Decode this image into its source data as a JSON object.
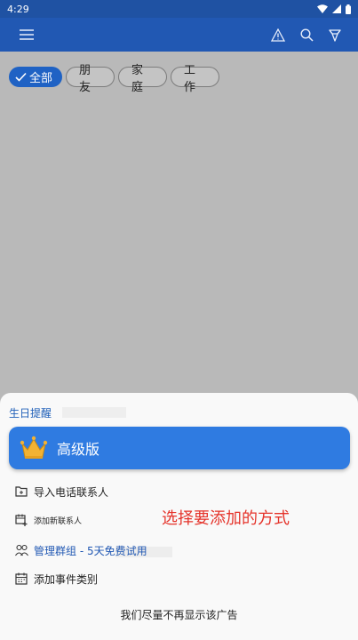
{
  "status_bar": {
    "time": "4:29"
  },
  "filters": [
    {
      "label": "全部",
      "selected": true
    },
    {
      "label": "朋友",
      "selected": false
    },
    {
      "label": "家庭",
      "selected": false
    },
    {
      "label": "工作",
      "selected": false
    }
  ],
  "sheet": {
    "title": "生日提醒",
    "premium_label": "高级版",
    "items": [
      {
        "label": "导入电话联系人",
        "icon": "folder-import-icon"
      },
      {
        "label": "添加新联系人",
        "icon": "add-contact-icon"
      },
      {
        "label": "管理群组 - 5天免费试用",
        "icon": "groups-icon"
      },
      {
        "label": "添加事件类别",
        "icon": "calendar-icon"
      }
    ],
    "footer": "我们尽量不再显示该广告"
  },
  "annotation": "选择要添加的方式",
  "colors": {
    "app_bar": "#2158b3",
    "accent": "#2f7be1",
    "annotation": "#e5332a"
  }
}
